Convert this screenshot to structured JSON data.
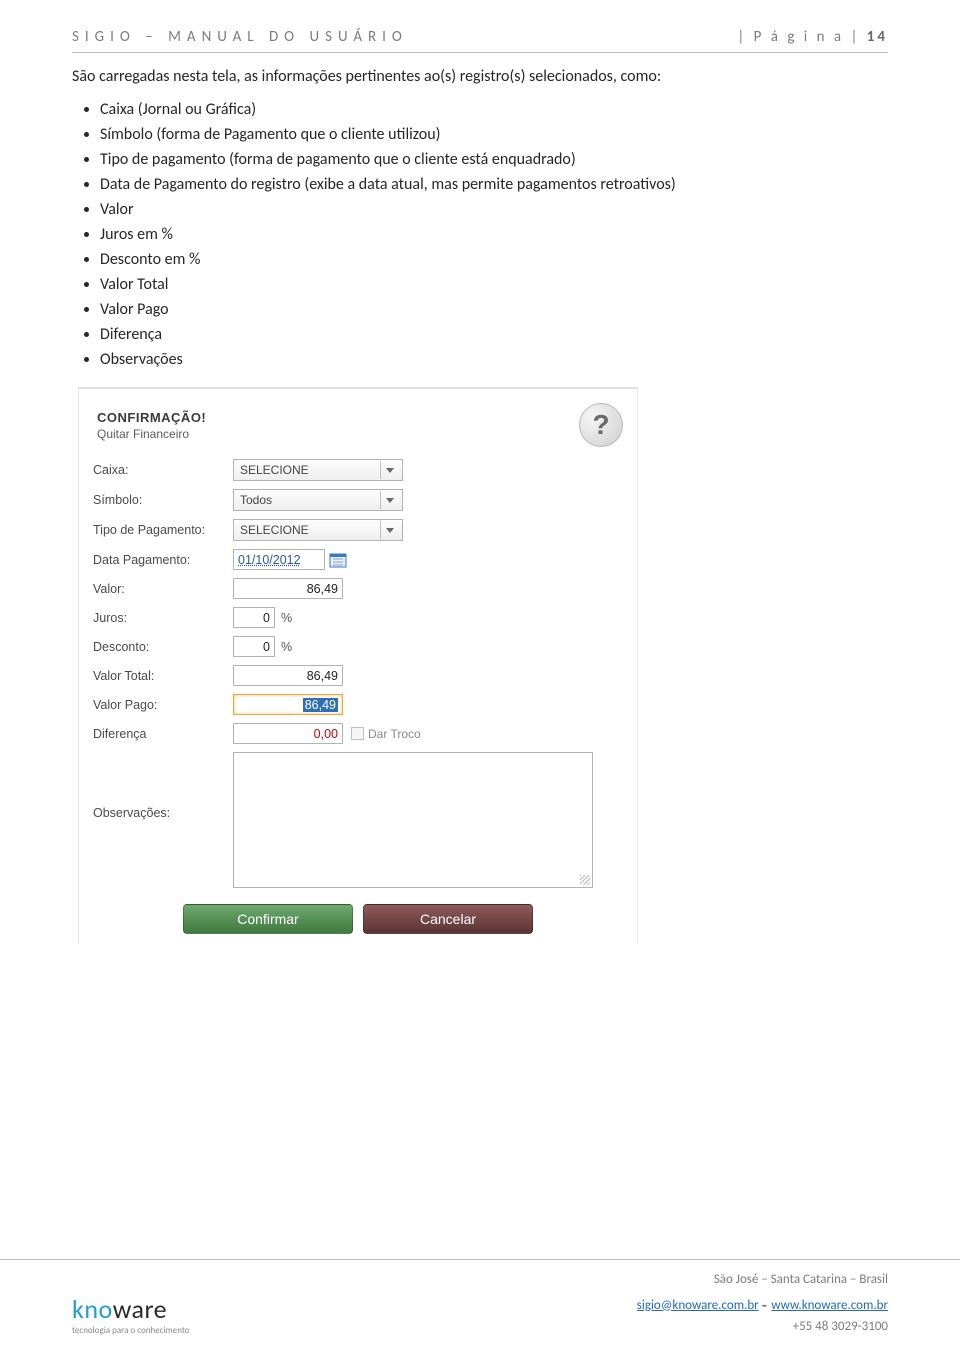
{
  "header": {
    "left": "SIGIO – MANUAL DO USUÁRIO",
    "right_label": "| P á g i n a | ",
    "right_num": "14"
  },
  "intro": "São carregadas nesta tela, as informações pertinentes ao(s) registro(s) selecionados, como:",
  "bullets": [
    "Caixa (Jornal ou Gráfica)",
    "Símbolo (forma de Pagamento que o cliente utilizou)",
    "Tipo de pagamento (forma de pagamento que o cliente está enquadrado)",
    "Data de Pagamento do registro (exibe a data atual, mas permite pagamentos retroativos)",
    "Valor",
    "Juros em %",
    "Desconto em %",
    "Valor Total",
    "Valor Pago",
    "Diferença",
    "Observações"
  ],
  "form": {
    "title": "CONFIRMAÇÃO!",
    "subtitle": "Quitar Financeiro",
    "labels": {
      "caixa": "Caixa:",
      "simbolo": "Símbolo:",
      "tipo": "Tipo de Pagamento:",
      "data": "Data Pagamento:",
      "valor": "Valor:",
      "juros": "Juros:",
      "desconto": "Desconto:",
      "valor_total": "Valor Total:",
      "valor_pago": "Valor Pago:",
      "diferenca": "Diferença",
      "dar_troco": "Dar Troco",
      "observacoes": "Observações:"
    },
    "values": {
      "caixa": "SELECIONE",
      "simbolo": "Todos",
      "tipo": "SELECIONE",
      "data": "01/10/2012",
      "valor": "86,49",
      "juros": "0",
      "desconto": "0",
      "pct": "%",
      "valor_total": "86,49",
      "valor_pago": "86,49",
      "diferenca": "0,00"
    },
    "buttons": {
      "confirm": "Confirmar",
      "cancel": "Cancelar"
    }
  },
  "footer": {
    "brand_part1": "kno",
    "brand_part2": "ware",
    "tagline": "tecnologia para o conhecimento",
    "line1": "São José – Santa Catarina – Brasil",
    "email": "sigio@knoware.com.br",
    "dash": " - ",
    "site": "www.knoware.com.br",
    "phone": "+55 48 3029-3100"
  }
}
